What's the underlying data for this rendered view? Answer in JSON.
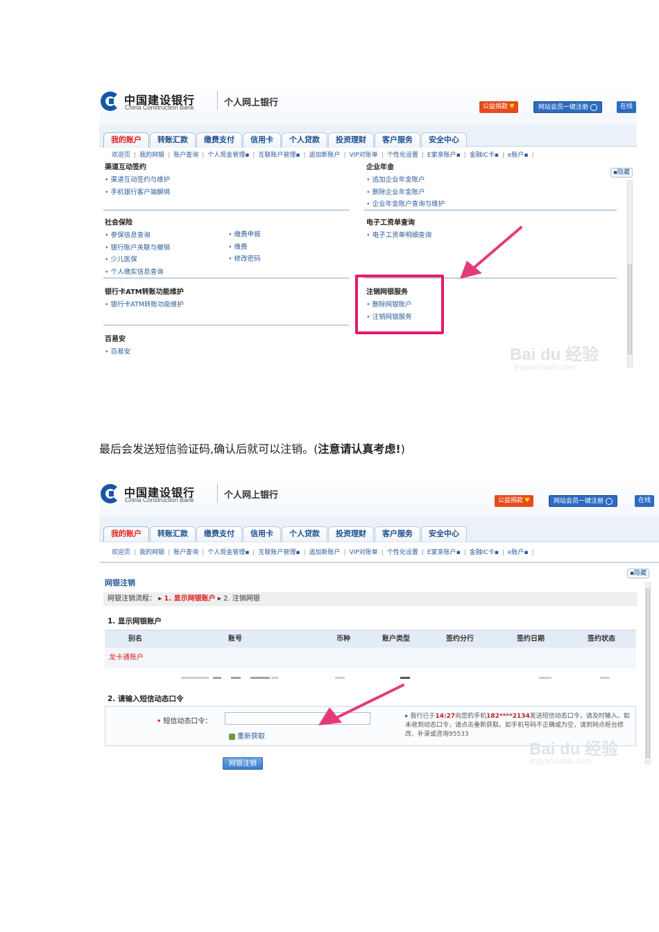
{
  "screenshot1": {
    "header": {
      "bank_name_cn": "中国建设银行",
      "bank_name_en": "China Construction Bank",
      "site_title": "个人网上银行",
      "btn_public": "公益捐款",
      "btn_member": "网站会员一键注册",
      "btn_online": "在线"
    },
    "tabs": [
      "我的账户",
      "转账汇款",
      "缴费支付",
      "信用卡",
      "个人贷款",
      "投资理财",
      "客户服务",
      "安全中心"
    ],
    "subnav": [
      "欢迎页",
      "我的网银",
      "账户查询",
      "个人现金管理▪",
      "互联账户管理▪",
      "追加新账户",
      "VIP对账单",
      "个性化设置",
      "E家亲账户▪",
      "金融IC卡▪",
      "e账户▪"
    ],
    "hide_label": "▪隐藏",
    "sections": {
      "top_left_title": "渠道互动签约",
      "top_left_links": [
        "渠道互动签约与维护",
        "手机银行客户端解绑"
      ],
      "top_right_title": "企业年金",
      "top_right_links": [
        "追加企业年金账户",
        "删除企业年金账户",
        "企业年金账户查询与维护"
      ],
      "social_title": "社会保险",
      "social_links_a": [
        "参保信息查询",
        "银行账户关联与撤销",
        "少儿医保",
        "个人缴实信息查询"
      ],
      "social_links_b": [
        "缴费申报",
        "缴费",
        "修改密码"
      ],
      "payroll_title": "电子工资单查询",
      "payroll_links": [
        "电子工资单明细查询"
      ],
      "atm_title": "银行卡ATM转账功能维护",
      "atm_links": [
        "银行卡ATM转账功能维护"
      ],
      "cancel_title": "注销网银服务",
      "cancel_links": [
        "删除网银账户",
        "注销网银服务"
      ],
      "baiyian_title": "百易安",
      "baiyian_links": [
        "百易安"
      ]
    },
    "watermark": "Bai du 经验",
    "watermark_url": "jingyan.baidu.com"
  },
  "caption": {
    "text": "最后会发送短信验证码,确认后就可以注销。(",
    "bold": "注意请认真考虑!",
    "end": ")"
  },
  "screenshot2": {
    "page_title": "网银注销",
    "flow_label": "网银注销流程：",
    "flow_step1": "1. 显示网银账户",
    "flow_step2": "2. 注销网银",
    "step1_title": "1. 显示网银账户",
    "table_headers": [
      "别名",
      "账号",
      "币种",
      "账户类型",
      "签约分行",
      "签约日期",
      "签约状态"
    ],
    "table_row_alias": "龙卡通账户",
    "step2_title": "2. 请输入短信动态口令",
    "otp_label": "短信动态口令：",
    "refetch": "重新获取",
    "notice_pre": "我行已于",
    "notice_time": "14:27",
    "notice_mid": "向您的手机",
    "notice_phone": "182****2134",
    "notice_post": "发送短信动态口令，请及时输入。如未收到动态口令，请点击重新获取。如手机号码不正确或为空，请到网点柜台修改、补录或咨询95533",
    "submit": "网银注销"
  },
  "colors": {
    "brand_blue": "#1457a5",
    "highlight_pink": "#e5196b",
    "arrow_pink": "#e53a78",
    "link_blue": "#2b5a9a"
  }
}
